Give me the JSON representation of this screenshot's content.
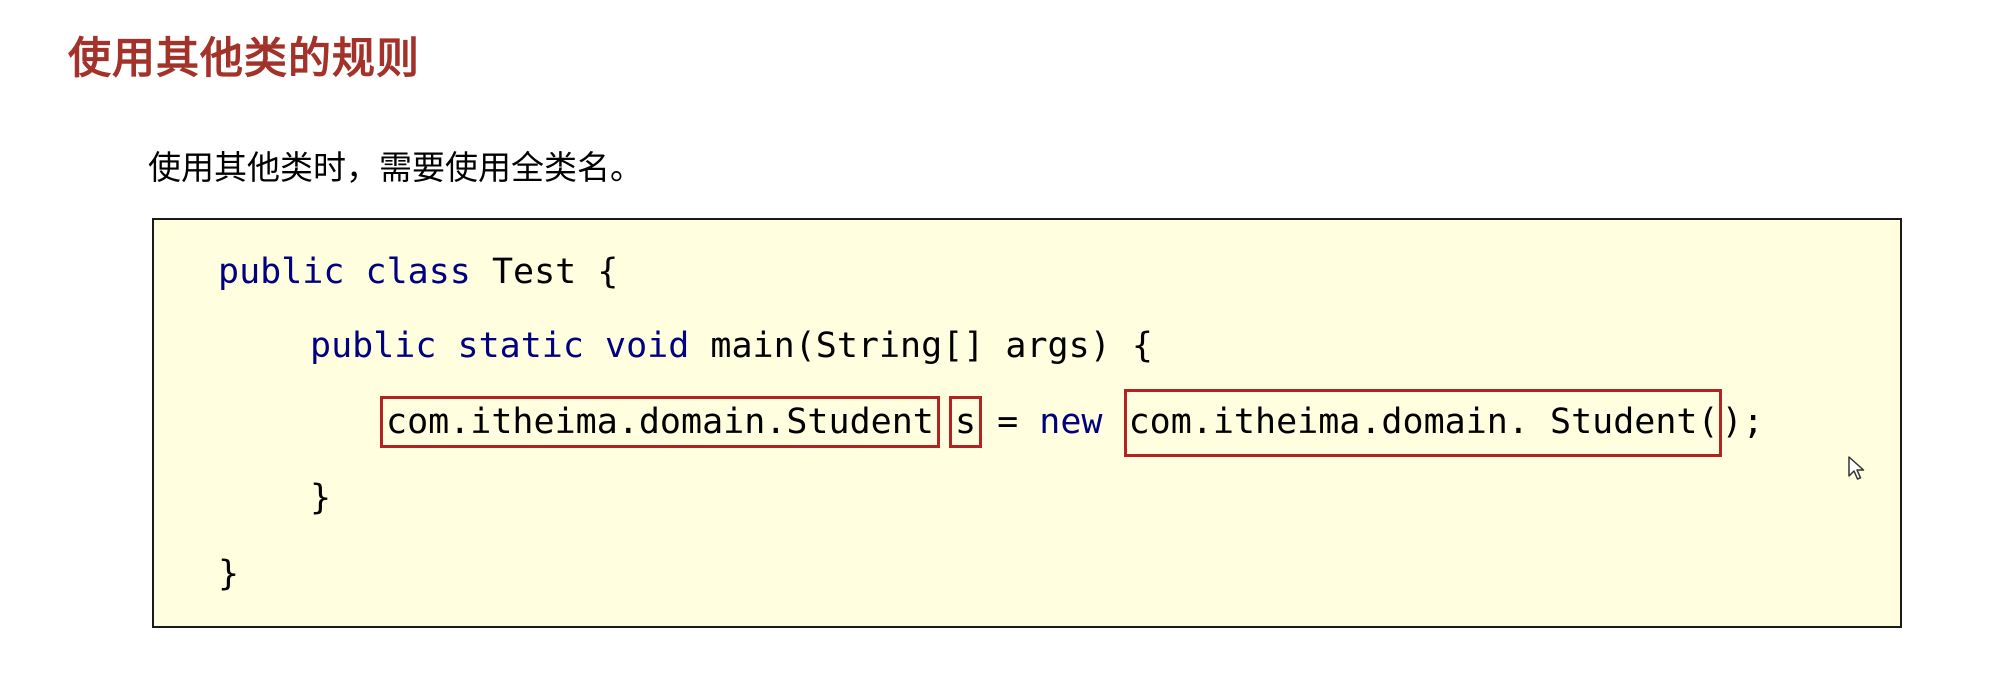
{
  "heading": "使用其他类的规则",
  "description": "使用其他类时，需要使用全类名。",
  "code": {
    "line1": {
      "kw1": "public",
      "kw2": "class",
      "rest": "Test {"
    },
    "line2": {
      "kw1": "public",
      "kw2": "static",
      "kw3": "void",
      "rest": "main(String[] args) {"
    },
    "line3": {
      "type_name": "com.itheima.domain.Student",
      "var_name": "s",
      "assign": "=",
      "kw_new": "new",
      "ctor_name": "com.itheima.domain. Student(",
      "ctor_end": ");"
    },
    "line4": "}",
    "line5": "}"
  },
  "colors": {
    "heading": "#a3322b",
    "keyword": "#000080",
    "highlight_box": "#b42323",
    "code_background": "#ffffe0"
  },
  "icons": [
    "mouse-cursor-icon"
  ]
}
